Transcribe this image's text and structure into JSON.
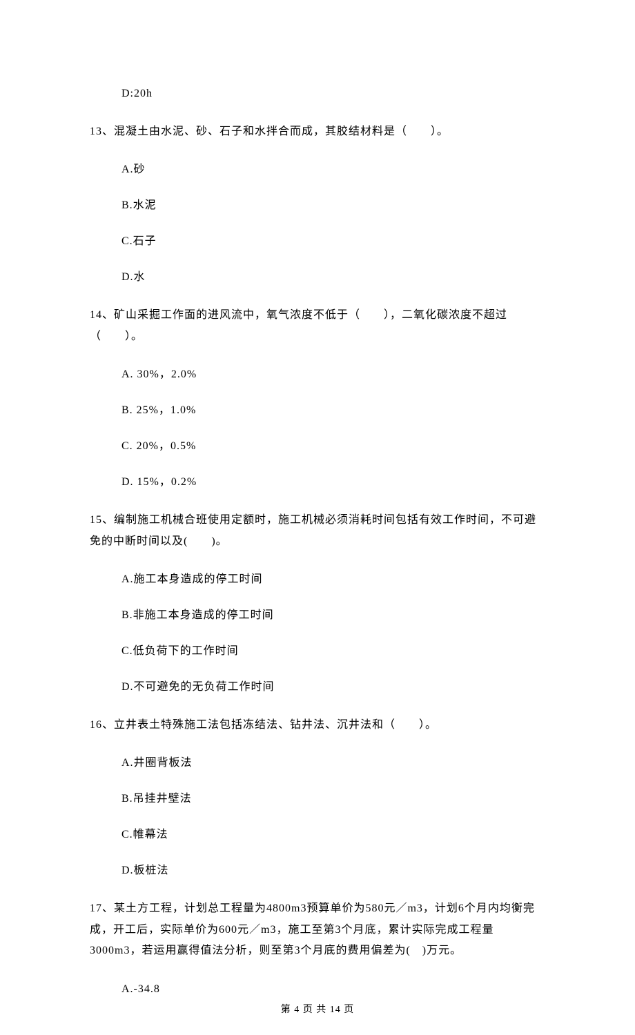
{
  "q12": {
    "optionD": "D:20h"
  },
  "q13": {
    "stem": "13、混凝土由水泥、砂、石子和水拌合而成，其胶结材料是（　　）。",
    "A": "A.砂",
    "B": "B.水泥",
    "C": "C.石子",
    "D": "D.水"
  },
  "q14": {
    "stem": "14、矿山采掘工作面的进风流中，氧气浓度不低于（　　），二氧化碳浓度不超过（　　）。",
    "A": "A.  30%，2.0%",
    "B": "B.  25%，1.0%",
    "C": "C.  20%，0.5%",
    "D": "D.  15%，0.2%"
  },
  "q15": {
    "stem": "15、编制施工机械合班使用定额时，施工机械必须消耗时间包括有效工作时间，不可避免的中断时间以及(　　)。",
    "A": "A.施工本身造成的停工时间",
    "B": "B.非施工本身造成的停工时间",
    "C": "C.低负荷下的工作时间",
    "D": "D.不可避免的无负荷工作时间"
  },
  "q16": {
    "stem": "16、立井表土特殊施工法包括冻结法、钻井法、沉井法和（　　）。",
    "A": "A.井圈背板法",
    "B": "B.吊挂井壁法",
    "C": "C.帷幕法",
    "D": "D.板桩法"
  },
  "q17": {
    "stem": "17、某土方工程，计划总工程量为4800m3预算单价为580元／m3，计划6个月内均衡完成，开工后，实际单价为600元／m3，施工至第3个月底，累计实际完成工程量3000m3，若运用赢得值法分析，则至第3个月底的费用偏差为(　)万元。",
    "A": "A.-34.8"
  },
  "footer": "第 4 页 共 14 页"
}
